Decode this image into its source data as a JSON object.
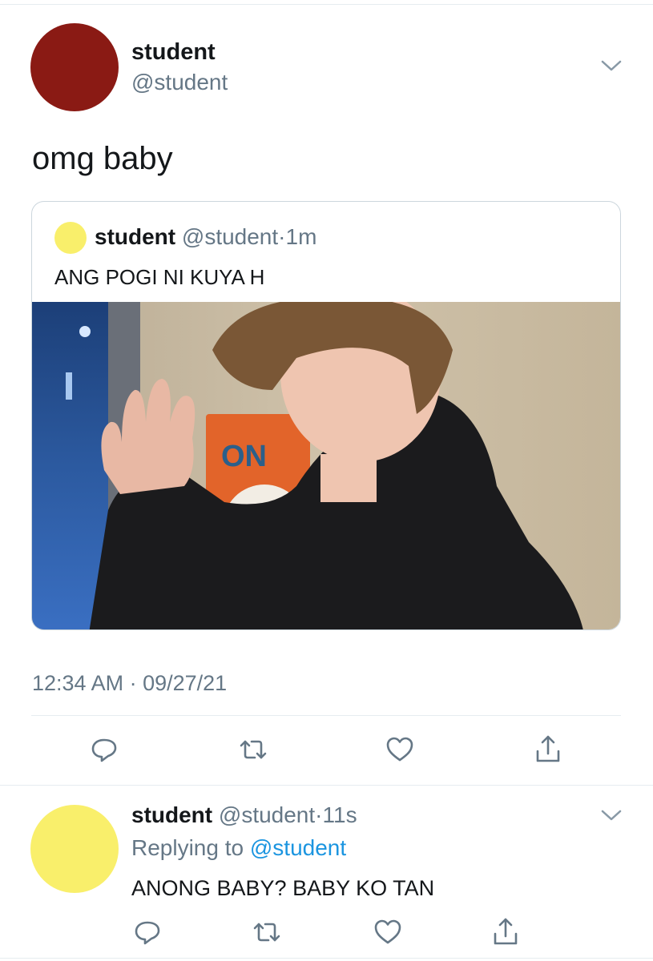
{
  "main_tweet": {
    "display_name": "student",
    "handle": "@student",
    "avatar_color": "#8a1a14",
    "text": "omg baby",
    "timestamp": "12:34 AM · 09/27/21"
  },
  "quoted_tweet": {
    "display_name": "student",
    "handle": "@student",
    "separator": "·",
    "age": "1m",
    "avatar_color": "#f9ef6b",
    "text": "ANG POGI NI KUYA H",
    "photo_sign_text": "ON"
  },
  "reply_tweet": {
    "display_name": "student",
    "handle": "@student",
    "separator": "·",
    "age": "11s",
    "avatar_color": "#f9ef6b",
    "replying_prefix": "Replying to",
    "replying_mention": "@student",
    "text": "ANONG BABY? BABY KO TAN"
  },
  "icons": {
    "actions": [
      "reply-icon",
      "retweet-icon",
      "like-icon",
      "share-icon"
    ],
    "menu": "chevron-down-icon"
  },
  "colors": {
    "text_primary": "#14171a",
    "text_secondary": "#657786",
    "link": "#1b95e0",
    "divider": "#e6ecf0"
  }
}
